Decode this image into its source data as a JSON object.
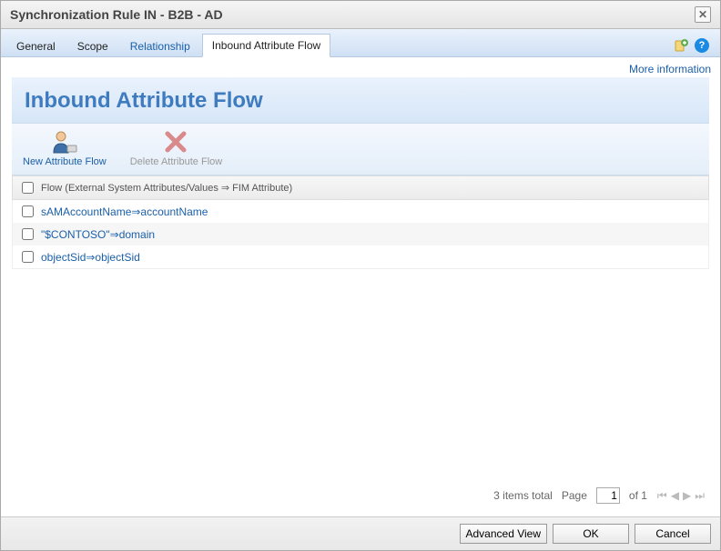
{
  "window": {
    "title": "Synchronization Rule IN - B2B - AD"
  },
  "tabs": [
    {
      "label": "General",
      "active": false,
      "link": false
    },
    {
      "label": "Scope",
      "active": false,
      "link": false
    },
    {
      "label": "Relationship",
      "active": false,
      "link": true
    },
    {
      "label": "Inbound Attribute Flow",
      "active": true,
      "link": false
    }
  ],
  "more_info": "More information",
  "panel": {
    "title": "Inbound Attribute Flow"
  },
  "toolbar": {
    "new_label": "New Attribute Flow",
    "delete_label": "Delete Attribute Flow"
  },
  "grid": {
    "header": "Flow (External System Attributes/Values ⇒ FIM Attribute)",
    "rows": [
      {
        "text": "sAMAccountName⇒accountName"
      },
      {
        "text": "\"$CONTOSO\"⇒domain"
      },
      {
        "text": "objectSid⇒objectSid"
      }
    ]
  },
  "paging": {
    "total_text": "3 items total",
    "page_label": "Page",
    "page_value": "1",
    "of_text": "of 1"
  },
  "footer": {
    "advanced": "Advanced View",
    "ok": "OK",
    "cancel": "Cancel"
  }
}
